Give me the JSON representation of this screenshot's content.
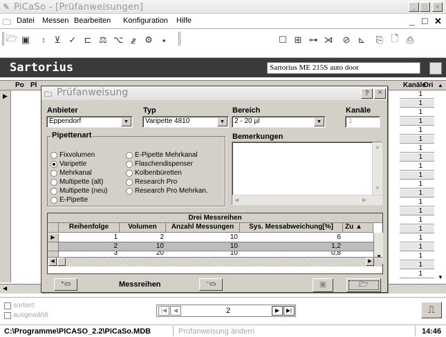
{
  "window": {
    "title": "PiCaSo - [Prüfanweisungen]",
    "controls": [
      "minimize",
      "maximize",
      "close"
    ]
  },
  "menu": {
    "items": [
      "Datei",
      "Messen",
      "Bearbeiten",
      "Konfiguration",
      "Hilfe"
    ],
    "mdi_controls": [
      "_",
      "□",
      "✕"
    ]
  },
  "toolbar": {
    "icons": [
      "open-icon",
      "save-icon",
      "sort-icon",
      "filter-icon",
      "check-icon",
      "balance-icon",
      "scale-icon",
      "pipette-icon",
      "z-icon",
      "globe-icon",
      "calc-icon",
      "single-icon",
      "multi-icon",
      "tree-icon",
      "cancel-icon",
      "edit-icon",
      "graph-icon",
      "copy-icon",
      "preview-icon",
      "print-icon"
    ]
  },
  "brandbar": {
    "brand": "Sartorius",
    "balance": "Sartorius ME 215S auto door"
  },
  "bg_grid": {
    "headers": [
      "Po",
      "Pl",
      "Kanäle",
      "Ori"
    ],
    "kanaele": [
      "1",
      "1",
      "1",
      "1",
      "1",
      "1",
      "1",
      "1",
      "1",
      "1",
      "1",
      "1",
      "1",
      "1",
      "1",
      "1",
      "1",
      "1",
      "1",
      "1",
      "1"
    ]
  },
  "dialog": {
    "title": "Prüfanweisung",
    "anbieter": {
      "label": "Anbieter",
      "value": "Eppendorf"
    },
    "typ": {
      "label": "Typ",
      "value": "Varipette 4810"
    },
    "bereich": {
      "label": "Bereich",
      "value": "2 - 20 µl"
    },
    "kanaele": {
      "label": "Kanäle",
      "value": "1"
    },
    "pipettenart": {
      "label": "Pipettenart",
      "options": [
        "Fixvolumen",
        "Varipette",
        "Mehrkanal",
        "Multipette (alt)",
        "Multipette (neu)",
        "E-Pipette",
        "E-Pipette Mehrkanal",
        "Flaschendispenser",
        "Kolbenbüretten",
        "Research Pro",
        "Research Pro Mehrkan."
      ],
      "selected": "Varipette"
    },
    "bemerkungen": {
      "label": "Bemerkungen",
      "value": ""
    },
    "messreihen": {
      "title": "Drei Messreihen",
      "columns": [
        "Reihenfolge",
        "Volumen",
        "Anzahl Messungen",
        "Sys. Messabweichung[%]",
        "Zu"
      ],
      "rows": [
        [
          "1",
          "2",
          "10",
          "6"
        ],
        [
          "2",
          "10",
          "10",
          "1,2"
        ],
        [
          "3",
          "20",
          "10",
          "0,8"
        ]
      ]
    },
    "messreihen_label": "Messreihen"
  },
  "bottom": {
    "sortiert": "sortiert",
    "ausgewaehlt": "ausgewählt",
    "page": "2"
  },
  "status": {
    "path": "C:\\Programme\\PICASO_2.2\\PiCaSo.MDB",
    "message": "Prüfanweisung ändern",
    "time": "14:46"
  }
}
